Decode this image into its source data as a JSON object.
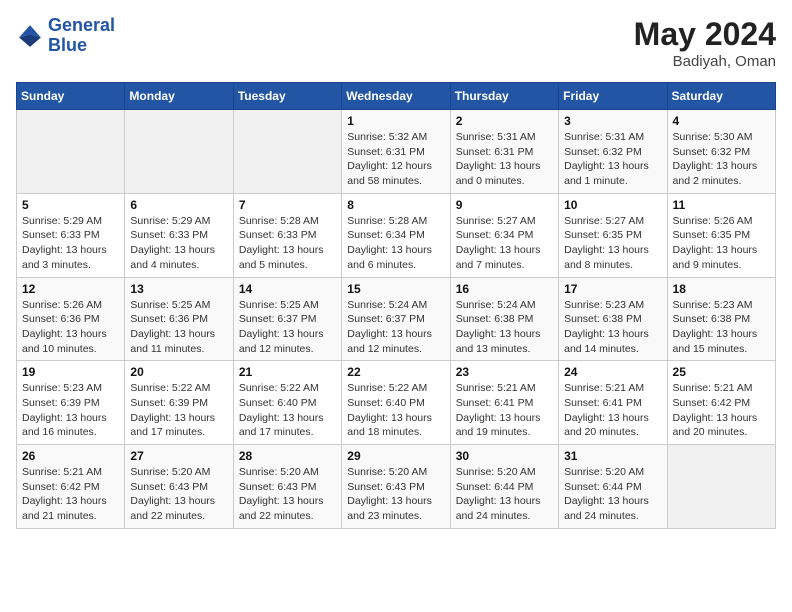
{
  "header": {
    "logo_line1": "General",
    "logo_line2": "Blue",
    "month_year": "May 2024",
    "location": "Badiyah, Oman"
  },
  "days_of_week": [
    "Sunday",
    "Monday",
    "Tuesday",
    "Wednesday",
    "Thursday",
    "Friday",
    "Saturday"
  ],
  "weeks": [
    [
      {
        "day": "",
        "info": ""
      },
      {
        "day": "",
        "info": ""
      },
      {
        "day": "",
        "info": ""
      },
      {
        "day": "1",
        "info": "Sunrise: 5:32 AM\nSunset: 6:31 PM\nDaylight: 12 hours\nand 58 minutes."
      },
      {
        "day": "2",
        "info": "Sunrise: 5:31 AM\nSunset: 6:31 PM\nDaylight: 13 hours\nand 0 minutes."
      },
      {
        "day": "3",
        "info": "Sunrise: 5:31 AM\nSunset: 6:32 PM\nDaylight: 13 hours\nand 1 minute."
      },
      {
        "day": "4",
        "info": "Sunrise: 5:30 AM\nSunset: 6:32 PM\nDaylight: 13 hours\nand 2 minutes."
      }
    ],
    [
      {
        "day": "5",
        "info": "Sunrise: 5:29 AM\nSunset: 6:33 PM\nDaylight: 13 hours\nand 3 minutes."
      },
      {
        "day": "6",
        "info": "Sunrise: 5:29 AM\nSunset: 6:33 PM\nDaylight: 13 hours\nand 4 minutes."
      },
      {
        "day": "7",
        "info": "Sunrise: 5:28 AM\nSunset: 6:33 PM\nDaylight: 13 hours\nand 5 minutes."
      },
      {
        "day": "8",
        "info": "Sunrise: 5:28 AM\nSunset: 6:34 PM\nDaylight: 13 hours\nand 6 minutes."
      },
      {
        "day": "9",
        "info": "Sunrise: 5:27 AM\nSunset: 6:34 PM\nDaylight: 13 hours\nand 7 minutes."
      },
      {
        "day": "10",
        "info": "Sunrise: 5:27 AM\nSunset: 6:35 PM\nDaylight: 13 hours\nand 8 minutes."
      },
      {
        "day": "11",
        "info": "Sunrise: 5:26 AM\nSunset: 6:35 PM\nDaylight: 13 hours\nand 9 minutes."
      }
    ],
    [
      {
        "day": "12",
        "info": "Sunrise: 5:26 AM\nSunset: 6:36 PM\nDaylight: 13 hours\nand 10 minutes."
      },
      {
        "day": "13",
        "info": "Sunrise: 5:25 AM\nSunset: 6:36 PM\nDaylight: 13 hours\nand 11 minutes."
      },
      {
        "day": "14",
        "info": "Sunrise: 5:25 AM\nSunset: 6:37 PM\nDaylight: 13 hours\nand 12 minutes."
      },
      {
        "day": "15",
        "info": "Sunrise: 5:24 AM\nSunset: 6:37 PM\nDaylight: 13 hours\nand 12 minutes."
      },
      {
        "day": "16",
        "info": "Sunrise: 5:24 AM\nSunset: 6:38 PM\nDaylight: 13 hours\nand 13 minutes."
      },
      {
        "day": "17",
        "info": "Sunrise: 5:23 AM\nSunset: 6:38 PM\nDaylight: 13 hours\nand 14 minutes."
      },
      {
        "day": "18",
        "info": "Sunrise: 5:23 AM\nSunset: 6:38 PM\nDaylight: 13 hours\nand 15 minutes."
      }
    ],
    [
      {
        "day": "19",
        "info": "Sunrise: 5:23 AM\nSunset: 6:39 PM\nDaylight: 13 hours\nand 16 minutes."
      },
      {
        "day": "20",
        "info": "Sunrise: 5:22 AM\nSunset: 6:39 PM\nDaylight: 13 hours\nand 17 minutes."
      },
      {
        "day": "21",
        "info": "Sunrise: 5:22 AM\nSunset: 6:40 PM\nDaylight: 13 hours\nand 17 minutes."
      },
      {
        "day": "22",
        "info": "Sunrise: 5:22 AM\nSunset: 6:40 PM\nDaylight: 13 hours\nand 18 minutes."
      },
      {
        "day": "23",
        "info": "Sunrise: 5:21 AM\nSunset: 6:41 PM\nDaylight: 13 hours\nand 19 minutes."
      },
      {
        "day": "24",
        "info": "Sunrise: 5:21 AM\nSunset: 6:41 PM\nDaylight: 13 hours\nand 20 minutes."
      },
      {
        "day": "25",
        "info": "Sunrise: 5:21 AM\nSunset: 6:42 PM\nDaylight: 13 hours\nand 20 minutes."
      }
    ],
    [
      {
        "day": "26",
        "info": "Sunrise: 5:21 AM\nSunset: 6:42 PM\nDaylight: 13 hours\nand 21 minutes."
      },
      {
        "day": "27",
        "info": "Sunrise: 5:20 AM\nSunset: 6:43 PM\nDaylight: 13 hours\nand 22 minutes."
      },
      {
        "day": "28",
        "info": "Sunrise: 5:20 AM\nSunset: 6:43 PM\nDaylight: 13 hours\nand 22 minutes."
      },
      {
        "day": "29",
        "info": "Sunrise: 5:20 AM\nSunset: 6:43 PM\nDaylight: 13 hours\nand 23 minutes."
      },
      {
        "day": "30",
        "info": "Sunrise: 5:20 AM\nSunset: 6:44 PM\nDaylight: 13 hours\nand 24 minutes."
      },
      {
        "day": "31",
        "info": "Sunrise: 5:20 AM\nSunset: 6:44 PM\nDaylight: 13 hours\nand 24 minutes."
      },
      {
        "day": "",
        "info": ""
      }
    ]
  ]
}
